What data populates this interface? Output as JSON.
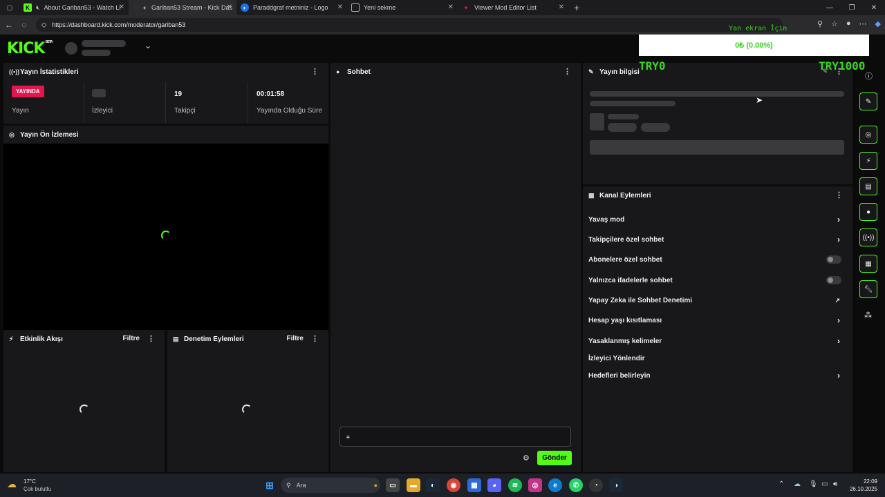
{
  "browser": {
    "tabs": [
      {
        "title": "About Gariban53 - Watch Li",
        "fav_color": "#53fc18",
        "fav_glyph": "K"
      },
      {
        "title": "Gariban53 Stream - Kick Das",
        "fav_color": "#3a7bd5",
        "fav_glyph": "◌"
      },
      {
        "title": "Paraddgraf metniniz - Logo",
        "fav_color": "#1a73e8",
        "fav_glyph": "◐"
      },
      {
        "title": "Yeni sekme",
        "fav_color": "#555",
        "fav_glyph": "▭"
      },
      {
        "title": "Viewer Mod Editor List",
        "fav_color": "#e2164e",
        "fav_glyph": "✦"
      }
    ],
    "url": "https://dashboard.kick.com/moderator/gariban53"
  },
  "overlay": {
    "label": "Yan ekran İçin",
    "box_text": "0₺ (0.00%)",
    "left_value": "TRY0",
    "right_value": "TRY1000",
    "color": "#39d41f"
  },
  "header": {
    "logo": "KICK",
    "logo_badge": "BETA"
  },
  "stats_panel": {
    "title": "Yayın İstatistikleri",
    "live_badge": "YAYINDA",
    "stats": [
      {
        "value": "",
        "label": "Yayın"
      },
      {
        "value": "",
        "label": "İzleyici"
      },
      {
        "value": "19",
        "label": "Takipçi"
      },
      {
        "value": "00:01:58",
        "label": "Yayında Olduğu Süre"
      }
    ]
  },
  "preview_panel": {
    "title": "Yayın Ön İzlemesi"
  },
  "activity_panel": {
    "title": "Etkinlik Akışı",
    "filter": "Filtre"
  },
  "moderation_panel": {
    "title": "Denetim Eylemleri",
    "filter": "Filtre"
  },
  "chat_panel": {
    "title": "Sohbet",
    "send_label": "Gönder"
  },
  "stream_info_panel": {
    "title": "Yayın bilgisi"
  },
  "channel_actions": {
    "title": "Kanal Eylemleri",
    "items": [
      {
        "label": "Yavaş mod",
        "control": "chevron"
      },
      {
        "label": "Takipçilere özel sohbet",
        "control": "chevron"
      },
      {
        "label": "Abonelere özel sohbet",
        "control": "toggle",
        "on": false
      },
      {
        "label": "Yalnızca ifadelerle sohbet",
        "control": "toggle",
        "on": false
      },
      {
        "label": "Yapay Zeka ile Sohbet Denetimi",
        "control": "external"
      },
      {
        "label": "Hesap yaşı kısıtlaması",
        "control": "chevron"
      },
      {
        "label": "Yasaklanmış kelimeler",
        "control": "chevron"
      },
      {
        "label": "İzleyici Yönlendir",
        "control": "none"
      },
      {
        "label": "Hedefleri belirleyin",
        "control": "chevron"
      }
    ]
  },
  "colors": {
    "accent": "#53fc18",
    "live": "#e2164e",
    "panel": "#18181a",
    "background": "#0b0b0c"
  },
  "taskbar": {
    "weather_temp": "17°C",
    "weather_desc": "Çok bulutlu",
    "search_placeholder": "Ara",
    "time": "22:09",
    "date": "26.10.2025"
  }
}
